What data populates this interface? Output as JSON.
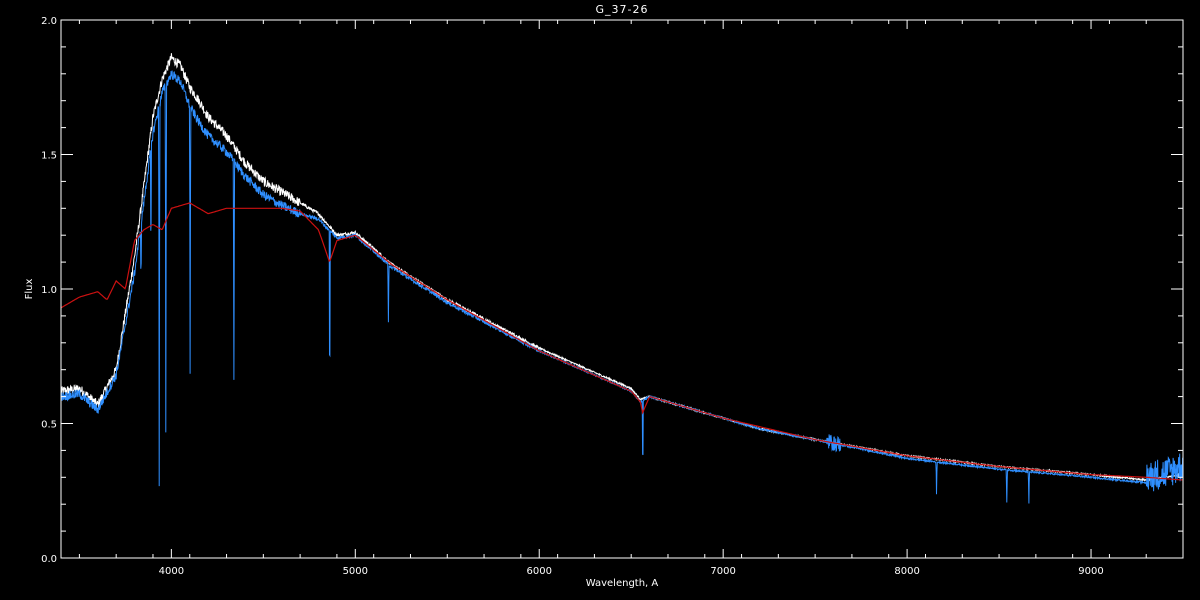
{
  "chart_data": {
    "type": "line",
    "title": "G_37-26",
    "xlabel": "Wavelength, A",
    "ylabel": "Flux",
    "xlim": [
      3400,
      9500
    ],
    "ylim": [
      0.0,
      2.0
    ],
    "x_ticks": [
      4000,
      5000,
      6000,
      7000,
      8000,
      9000
    ],
    "y_ticks": [
      0.0,
      0.5,
      1.0,
      1.5,
      2.0
    ],
    "x_tick_labels": [
      "4000",
      "5000",
      "6000",
      "7000",
      "8000",
      "9000"
    ],
    "y_tick_labels": [
      "0.0",
      "0.5",
      "1.0",
      "1.5",
      "2.0"
    ],
    "grid": false,
    "background": "#000000",
    "series": [
      {
        "color": "#ffffff",
        "x": [
          3400,
          3500,
          3600,
          3700,
          3800,
          3850,
          3900,
          3950,
          4000,
          4050,
          4100,
          4150,
          4200,
          4300,
          4400,
          4500,
          4600,
          4700,
          4800,
          4900,
          5000,
          5200,
          5500,
          6000,
          6500,
          6550,
          6600,
          6700,
          6800,
          7000,
          7200,
          7500,
          8000,
          8500,
          9000,
          9300,
          9400,
          9500
        ],
        "y": [
          0.62,
          0.63,
          0.57,
          0.7,
          1.12,
          1.38,
          1.64,
          1.78,
          1.86,
          1.83,
          1.75,
          1.7,
          1.64,
          1.57,
          1.47,
          1.4,
          1.36,
          1.32,
          1.28,
          1.2,
          1.21,
          1.09,
          0.96,
          0.78,
          0.63,
          0.59,
          0.6,
          0.58,
          0.56,
          0.52,
          0.48,
          0.44,
          0.38,
          0.34,
          0.31,
          0.29,
          0.3,
          0.31
        ]
      },
      {
        "color": "#2f8fff",
        "x": [
          3400,
          3500,
          3600,
          3700,
          3800,
          3850,
          3900,
          3950,
          4000,
          4050,
          4100,
          4150,
          4200,
          4300,
          4400,
          4500,
          4600,
          4700,
          4800,
          4900,
          5000,
          5200,
          5500,
          6000,
          6500,
          6550,
          6600,
          6700,
          6800,
          7000,
          7200,
          7500,
          8000,
          8500,
          9000,
          9300,
          9400,
          9500
        ],
        "y": [
          0.6,
          0.61,
          0.55,
          0.68,
          1.06,
          1.32,
          1.58,
          1.73,
          1.8,
          1.77,
          1.68,
          1.62,
          1.57,
          1.51,
          1.42,
          1.35,
          1.31,
          1.28,
          1.26,
          1.19,
          1.2,
          1.08,
          0.95,
          0.77,
          0.62,
          0.58,
          0.6,
          0.58,
          0.56,
          0.52,
          0.48,
          0.44,
          0.37,
          0.33,
          0.3,
          0.28,
          0.29,
          0.32
        ]
      },
      {
        "color": "#cc1111",
        "x": [
          3400,
          3500,
          3600,
          3650,
          3700,
          3750,
          3800,
          3850,
          3900,
          3950,
          4000,
          4100,
          4200,
          4300,
          4400,
          4500,
          4600,
          4700,
          4800,
          4850,
          4860,
          4900,
          5000,
          5200,
          5500,
          6000,
          6500,
          6550,
          6562,
          6600,
          6700,
          6800,
          7000,
          7500,
          8000,
          8500,
          9000,
          9300,
          9500
        ],
        "y": [
          0.93,
          0.97,
          0.99,
          0.96,
          1.03,
          1.0,
          1.18,
          1.22,
          1.24,
          1.22,
          1.3,
          1.32,
          1.28,
          1.3,
          1.3,
          1.3,
          1.3,
          1.29,
          1.22,
          1.12,
          1.1,
          1.18,
          1.2,
          1.09,
          0.96,
          0.77,
          0.62,
          0.58,
          0.54,
          0.6,
          0.58,
          0.56,
          0.52,
          0.44,
          0.38,
          0.34,
          0.31,
          0.3,
          0.29
        ]
      }
    ],
    "absorption_lines": [
      {
        "x": 3835,
        "depth": 0.25
      },
      {
        "x": 3889,
        "depth": 0.45
      },
      {
        "x": 3934,
        "depth": 1.4
      },
      {
        "x": 3970,
        "depth": 1.3
      },
      {
        "x": 4102,
        "depth": 1.0
      },
      {
        "x": 4340,
        "depth": 0.8
      },
      {
        "x": 4861,
        "depth": 0.7
      },
      {
        "x": 5180,
        "depth": 0.22
      },
      {
        "x": 6563,
        "depth": 0.3
      },
      {
        "x": 8160,
        "depth": 0.12
      },
      {
        "x": 8542,
        "depth": 0.12
      },
      {
        "x": 8662,
        "depth": 0.12
      }
    ]
  }
}
